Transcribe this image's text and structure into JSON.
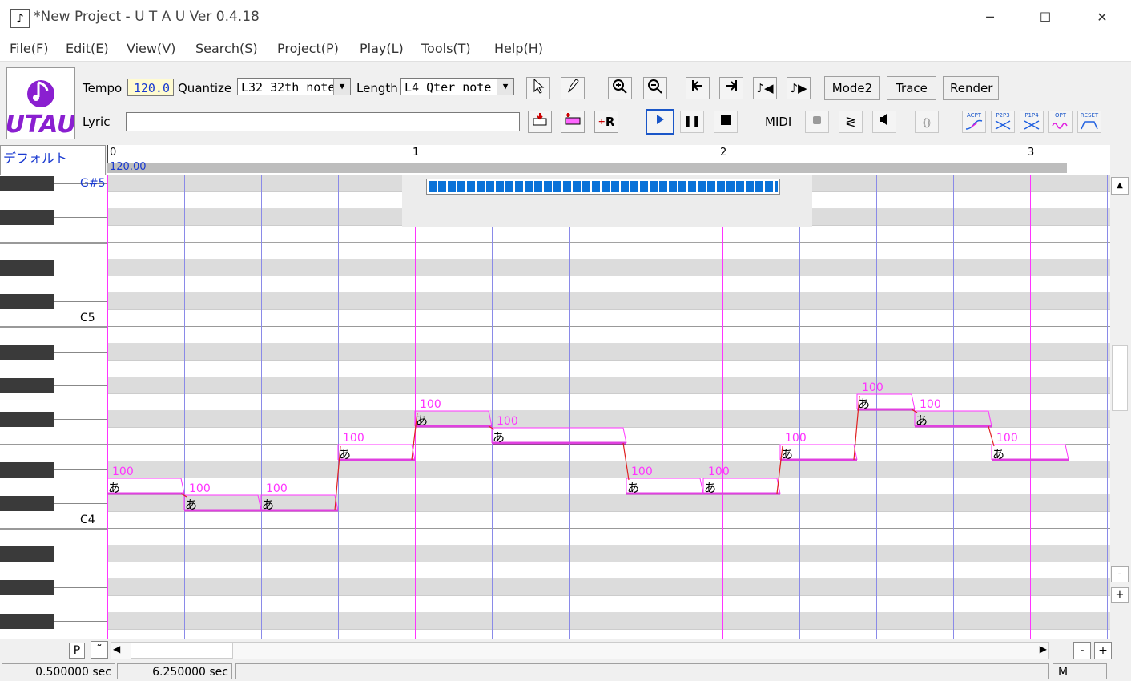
{
  "window": {
    "title": "*New Project - U T A U Ver 0.4.18",
    "icon": "music-note-icon",
    "controls": {
      "minimize": "─",
      "maximize": "☐",
      "close": "✕"
    }
  },
  "menu": [
    "File(F)",
    "Edit(E)",
    "View(V)",
    "Search(S)",
    "Project(P)",
    "Play(L)",
    "Tools(T)",
    "Help(H)"
  ],
  "toolbar": {
    "logo_text": "UTAU",
    "tempo_label": "Tempo",
    "tempo_value": "120.0",
    "quantize_label": "Quantize",
    "quantize_value": "L32 32th note",
    "length_label": "Length",
    "length_value": "L4  Qter note",
    "lyric_label": "Lyric",
    "lyric_value": "",
    "midi_label": "MIDI",
    "mode_label": "Mode2",
    "trace_label": "Trace",
    "render_label": "Render",
    "tool_icons": [
      "pointer-icon",
      "pencil-icon",
      "zoom-in-icon",
      "zoom-out-icon",
      "go-start-icon",
      "go-end-icon",
      "prev-note-icon",
      "next-note-icon"
    ],
    "row2_icons": [
      "insert-note-icon",
      "insert-rest-icon",
      "insert-r-icon",
      "play-icon",
      "pause-icon",
      "stop-icon",
      "record-icon",
      "lines-icon",
      "speaker-icon",
      "link-icon"
    ],
    "pitch_labels": [
      "ACPT",
      "P2P3",
      "P1P4",
      "OPT",
      "RESET"
    ]
  },
  "track": {
    "name": "デフォルト",
    "tempo_marker": "120.00",
    "measures": [
      "0",
      "1",
      "2",
      "3"
    ]
  },
  "piano": {
    "labels": [
      "G#5",
      "C5",
      "C4"
    ]
  },
  "roll": {
    "accent_color": "#ff33ff",
    "bar_color": "#e040e0",
    "line_color": "#8a8ae8",
    "lyric": "あ",
    "notes": [
      {
        "start": 0,
        "length": 480,
        "pitch": "D4",
        "velocity": "100"
      },
      {
        "start": 480,
        "length": 480,
        "pitch": "C#4",
        "velocity": "100"
      },
      {
        "start": 960,
        "length": 480,
        "pitch": "C#4",
        "velocity": "100"
      },
      {
        "start": 1440,
        "length": 480,
        "pitch": "E4",
        "velocity": "100"
      },
      {
        "start": 1920,
        "length": 480,
        "pitch": "F#4",
        "velocity": "100"
      },
      {
        "start": 2400,
        "length": 840,
        "pitch": "F4",
        "velocity": "100"
      },
      {
        "start": 3240,
        "length": 480,
        "pitch": "D4",
        "velocity": "100"
      },
      {
        "start": 3720,
        "length": 480,
        "pitch": "D4",
        "velocity": "100"
      },
      {
        "start": 4200,
        "length": 480,
        "pitch": "E4",
        "velocity": "100"
      },
      {
        "start": 4680,
        "length": 360,
        "pitch": "G4",
        "velocity": "100"
      },
      {
        "start": 5040,
        "length": 480,
        "pitch": "F#4",
        "velocity": "100"
      },
      {
        "start": 5520,
        "length": 480,
        "pitch": "E4",
        "velocity": "100"
      }
    ]
  },
  "render_progress": 1.0,
  "hscroll": {
    "p_label": "P",
    "tilde_label": "˜",
    "minus": "-",
    "plus": "+"
  },
  "vscroll": {
    "minus": "-",
    "plus": "+"
  },
  "status": {
    "time1": "0.500000 sec",
    "time2": "6.250000 sec",
    "mode": "M"
  }
}
